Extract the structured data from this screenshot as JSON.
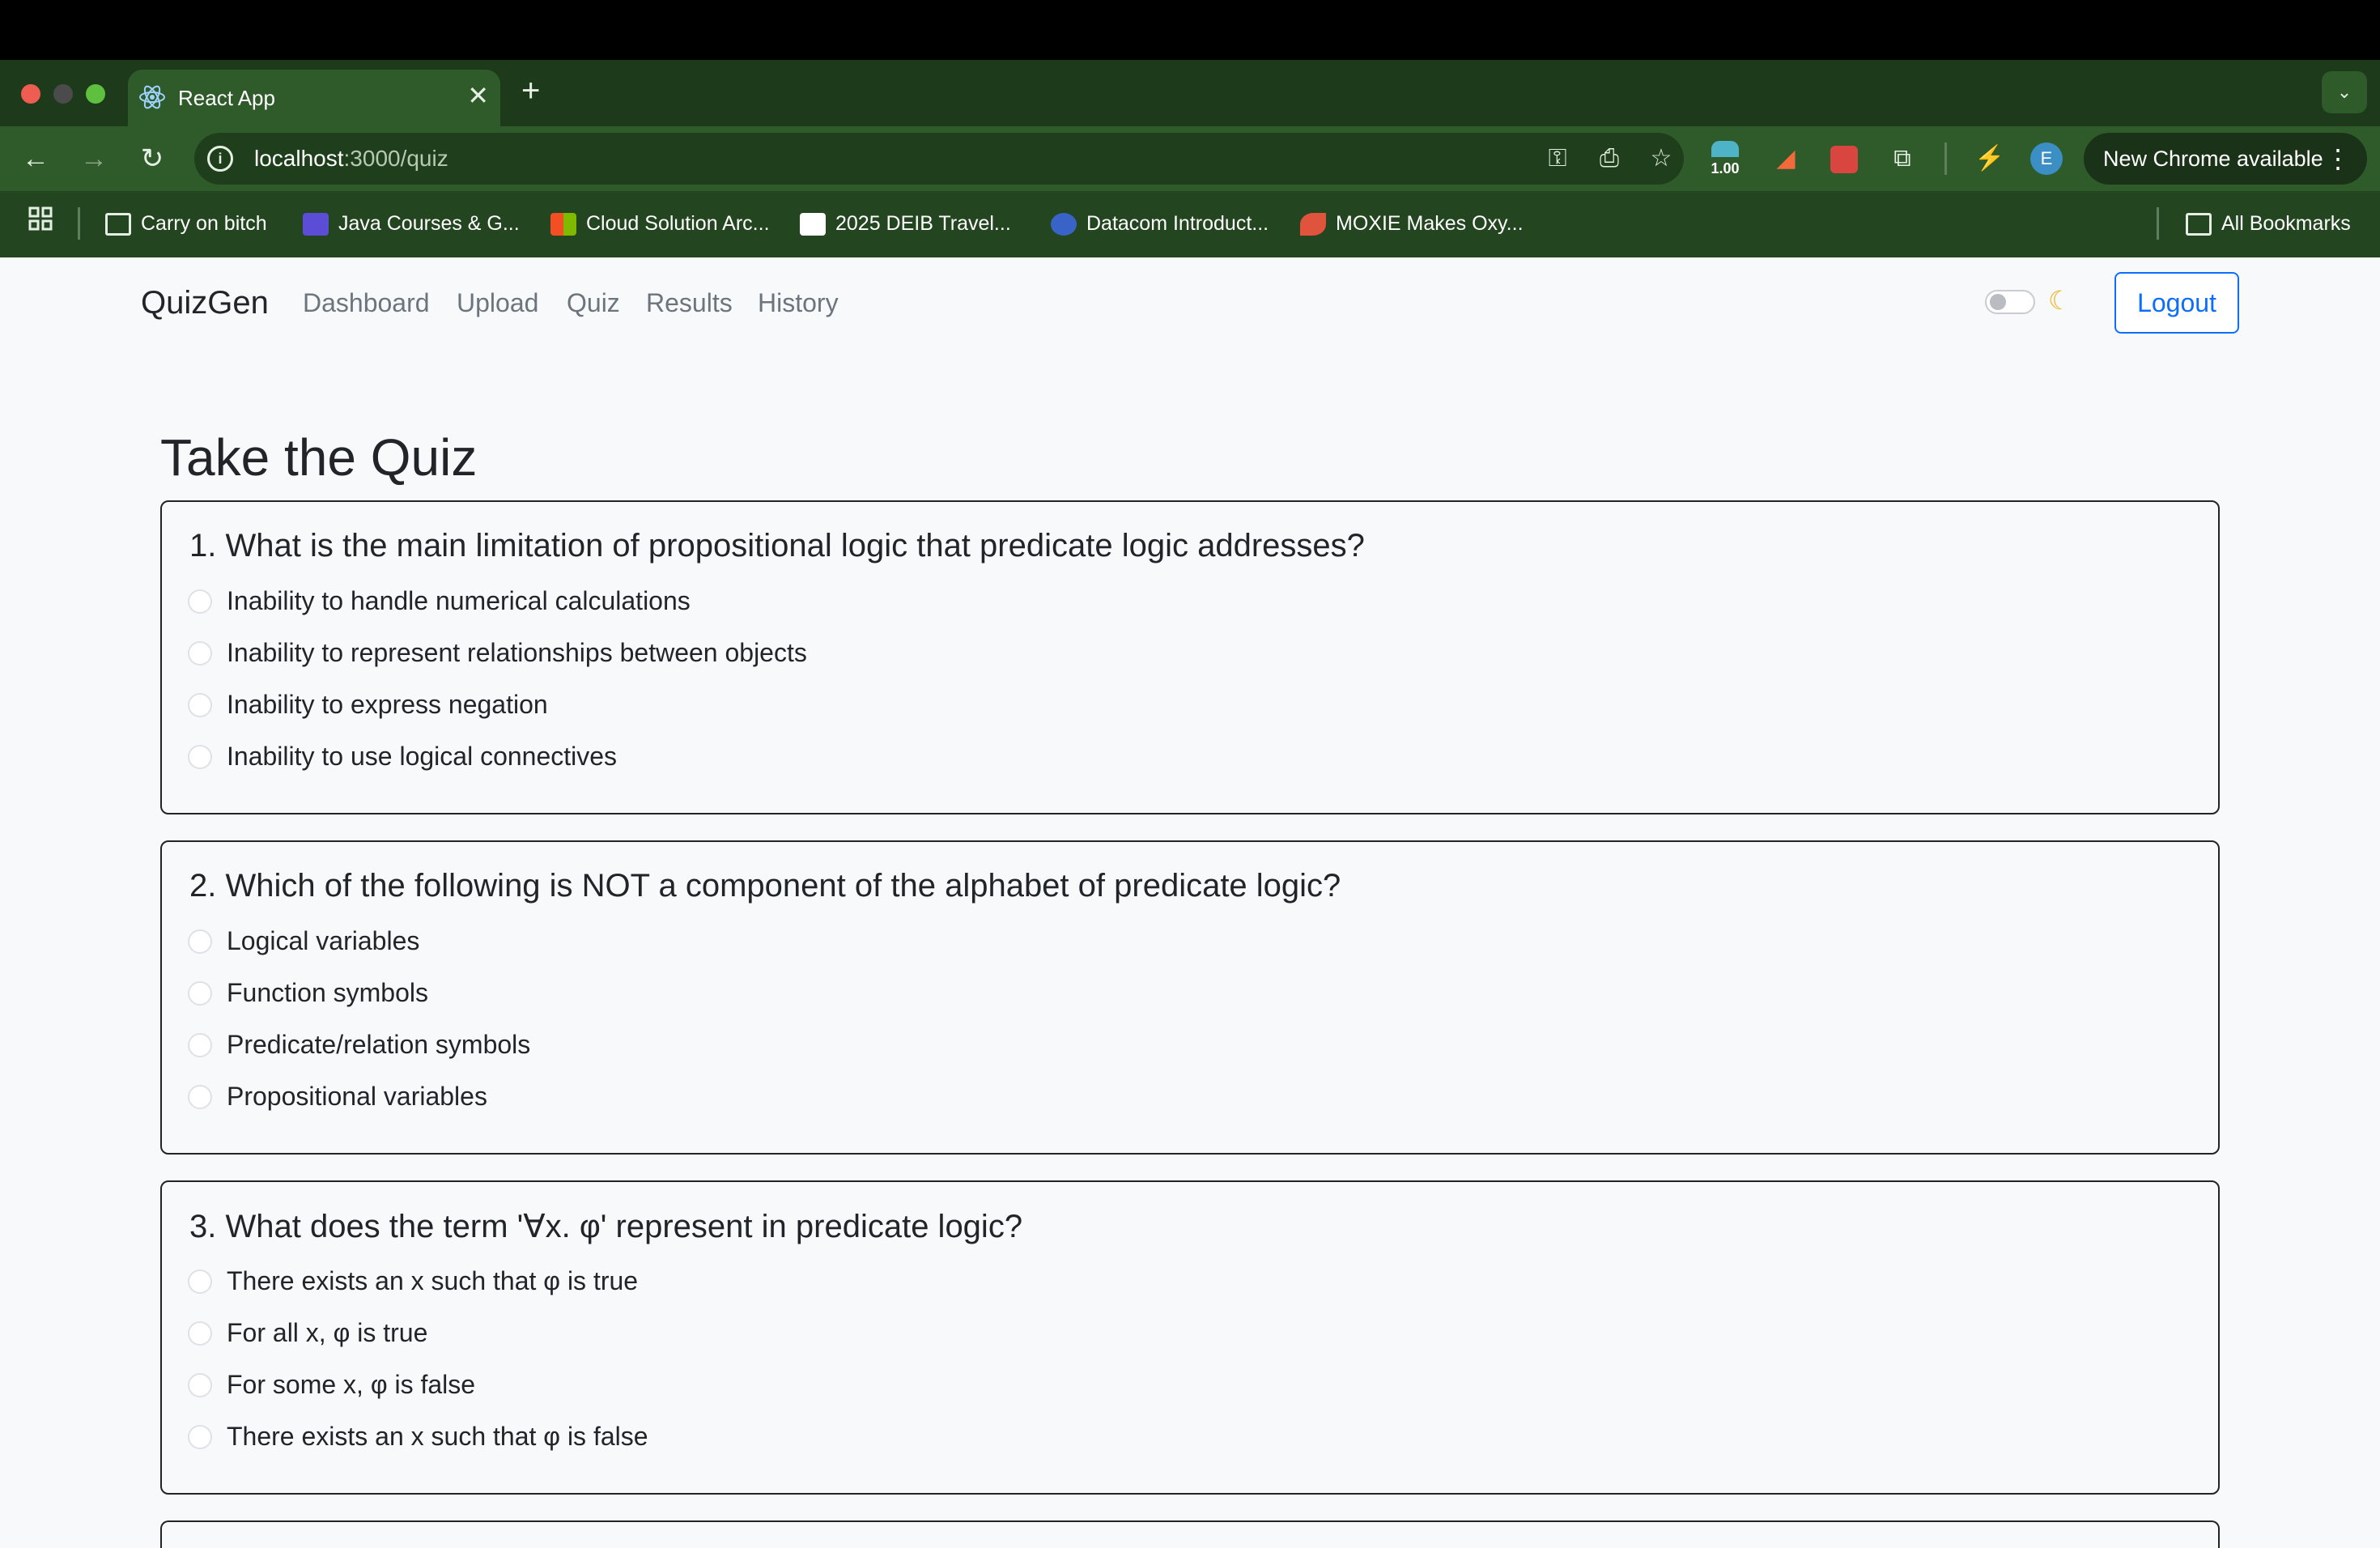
{
  "browser": {
    "tab_title": "React App",
    "url_host": "localhost",
    "url_path": ":3000/quiz",
    "extension_badge": "1.00",
    "profile_initial": "E",
    "update_label": "New Chrome available",
    "bookmarks": [
      {
        "label": "Carry on bitch",
        "icon": "folder-icon"
      },
      {
        "label": "Java Courses & G...",
        "icon": "terminal-icon"
      },
      {
        "label": "Cloud Solution Arc...",
        "icon": "microsoft-icon"
      },
      {
        "label": "2025 DEIB Travel...",
        "icon": "doc-icon"
      },
      {
        "label": "Datacom Introduct...",
        "icon": "datacom-icon"
      },
      {
        "label": "MOXIE Makes Oxy...",
        "icon": "rocket-icon"
      }
    ],
    "all_bookmarks": "All Bookmarks"
  },
  "app": {
    "brand": "QuizGen",
    "nav": [
      "Dashboard",
      "Upload",
      "Quiz",
      "Results",
      "History"
    ],
    "logout": "Logout",
    "theme_toggle_on": false
  },
  "quiz": {
    "title": "Take the Quiz",
    "questions": [
      {
        "text": "1. What is the main limitation of propositional logic that predicate logic addresses?",
        "options": [
          "Inability to handle numerical calculations",
          "Inability to represent relationships between objects",
          "Inability to express negation",
          "Inability to use logical connectives"
        ]
      },
      {
        "text": "2. Which of the following is NOT a component of the alphabet of predicate logic?",
        "options": [
          "Logical variables",
          "Function symbols",
          "Predicate/relation symbols",
          "Propositional variables"
        ]
      },
      {
        "text": "3. What does the term '∀x. φ' represent in predicate logic?",
        "options": [
          "There exists an x such that φ is true",
          "For all x, φ is true",
          "For some x, φ is false",
          "There exists an x such that φ is false"
        ]
      }
    ]
  }
}
